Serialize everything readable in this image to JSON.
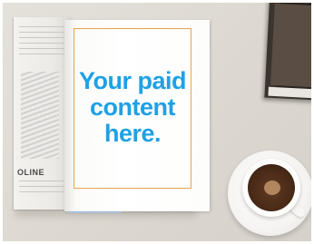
{
  "ad": {
    "headline_lines": [
      "Your paid",
      "content",
      "here."
    ],
    "accent_color": "#1fa1e3",
    "frame_color": "#e8a24a"
  },
  "magazine": {
    "left_page_word": "OLINE"
  },
  "scene_objects": [
    "open-magazine",
    "stacked-books",
    "coffee-cup"
  ]
}
